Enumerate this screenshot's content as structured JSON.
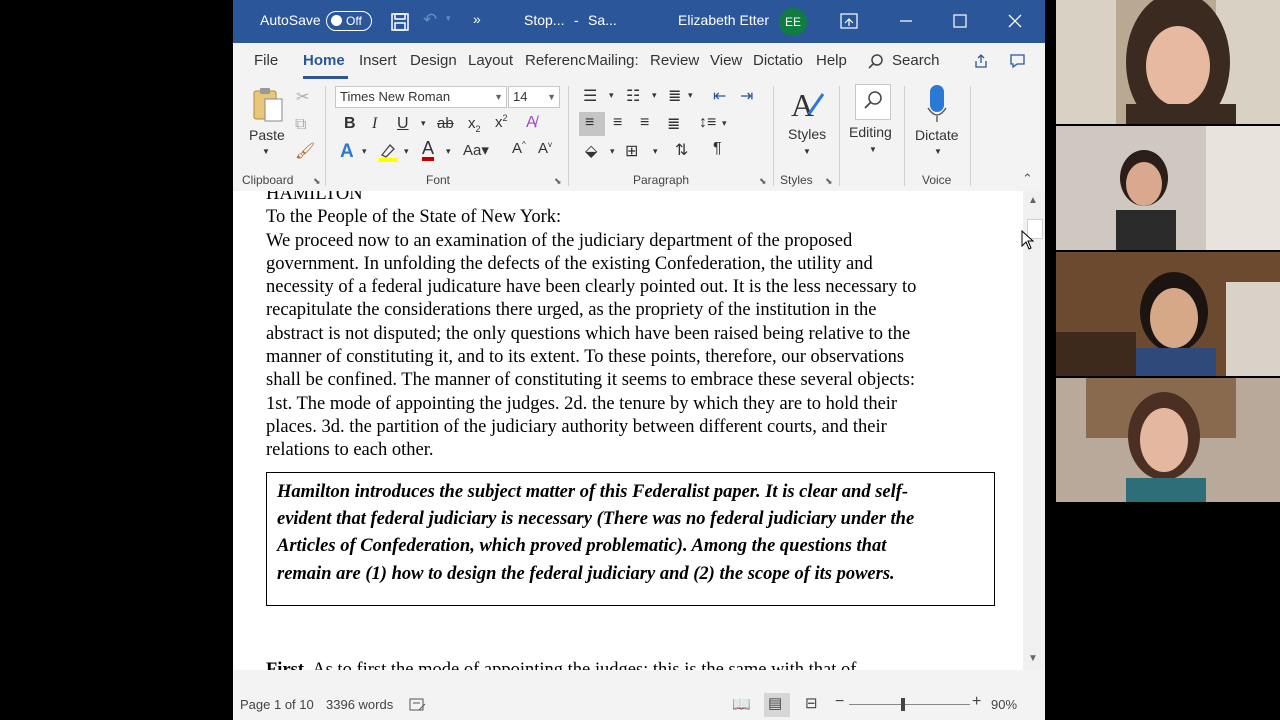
{
  "titlebar": {
    "autosave_label": "AutoSave",
    "autosave_state": "Off",
    "doc_title": "Stop...",
    "separator": "-",
    "save_status": "Sa...",
    "user_name": "Elizabeth Etter",
    "user_initials": "EE"
  },
  "tabs": [
    "File",
    "Home",
    "Insert",
    "Design",
    "Layout",
    "Referenc",
    "Mailing:",
    "Review",
    "View",
    "Dictatio",
    "Help"
  ],
  "search_label": "Search",
  "ribbon": {
    "paste_label": "Paste",
    "clipboard_label": "Clipboard",
    "font_name": "Times New Roman",
    "font_size": "14",
    "font_label": "Font",
    "paragraph_label": "Paragraph",
    "styles_button": "Styles",
    "styles_label": "Styles",
    "editing_label": "Editing",
    "dictate_label": "Dictate",
    "voice_label": "Voice"
  },
  "document": {
    "top_partial": "HAMILTON",
    "salutation": "To the People of the State of New York:",
    "paragraph_lines": [
      "We proceed now to an examination of the judiciary department of the proposed",
      "government. In unfolding the defects of the existing Confederation, the utility and",
      "necessity of a federal judicature have been clearly pointed out. It is the less necessary to",
      "recapitulate the considerations there urged, as the propriety of the institution in the",
      "abstract is not disputed; the only questions which have been raised being relative to the",
      "manner of constituting it, and to its extent. To these points, therefore, our observations",
      "shall be confined. The manner of constituting it seems to embrace these several objects:",
      "1st. The mode of appointing the judges. 2d. the tenure by which they are to hold their",
      "places. 3d. the partition of the judiciary authority between different courts, and their",
      "relations to each other."
    ],
    "box_lines": [
      "Hamilton introduces the subject matter of this Federalist paper.  It is clear and self-",
      "evident that federal judiciary is necessary (There was no federal judiciary under the",
      "Articles of Confederation, which proved problematic).   Among the questions that",
      "remain are (1) how to design the federal judiciary and (2) the scope of its powers."
    ],
    "next_bold": "First.",
    "next_text": " As to first the mode of appointing the judges; this is the same with that of"
  },
  "status": {
    "page": "Page 1 of 10",
    "words": "3396 words",
    "zoom": "90%",
    "zoom_level": 0.9
  },
  "colors": {
    "titlebar": "#2b579a",
    "accent": "#2b579a",
    "avatar": "#107c41",
    "font_color": "#c00000",
    "highlight": "#ffff00"
  }
}
